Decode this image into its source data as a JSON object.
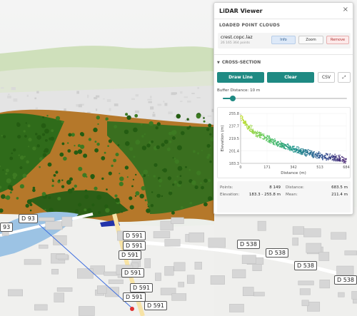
{
  "panel": {
    "title": "LiDAR Viewer",
    "close_icon": "×"
  },
  "loaded_point_clouds": {
    "label": "LOADED POINT CLOUDS",
    "items": [
      {
        "name": "crest.copc.laz",
        "points": "26 165 364 points",
        "info_label": "Info",
        "zoom_label": "Zoom",
        "remove_label": "Remove"
      }
    ]
  },
  "cross_section": {
    "label": "CROSS-SECTION",
    "chevron": "▼",
    "draw_line_label": "Draw Line",
    "clear_label": "Clear",
    "csv_label": "CSV",
    "expand_icon": "⤢",
    "buffer_label": "Buffer Distance: 10 m",
    "buffer_value": 10,
    "buffer_fraction": 0.08
  },
  "stats": {
    "points_label": "Points:",
    "points_value": "8 149",
    "distance_label": "Distance:",
    "distance_value": "683.5 m",
    "elevation_label": "Elevation:",
    "elevation_value": "183.3 - 255.8 m",
    "mean_label": "Mean:",
    "mean_value": "211.4 m"
  },
  "chart_data": {
    "type": "scatter",
    "xlabel": "Distance (m)",
    "ylabel": "Elevation (m)",
    "xlim": [
      0,
      684
    ],
    "ylim": [
      183.3,
      255.8
    ],
    "x_ticks": [
      "0",
      "171",
      "342",
      "513",
      "684"
    ],
    "y_ticks": [
      "255.8",
      "237.7",
      "219.5",
      "201.4",
      "183.3"
    ],
    "trend": [
      [
        0,
        250
      ],
      [
        40,
        237
      ],
      [
        100,
        226
      ],
      [
        171,
        218
      ],
      [
        260,
        209
      ],
      [
        342,
        203
      ],
      [
        430,
        197
      ],
      [
        513,
        193
      ],
      [
        600,
        190
      ],
      [
        684,
        187
      ]
    ],
    "spread": 7
  },
  "map": {
    "road_labels": [
      "D 93",
      "93",
      "D 591",
      "D 591",
      "D 591",
      "D 591",
      "D 591",
      "D 591",
      "D 591",
      "D 538",
      "D 538",
      "D 538",
      "D 538"
    ]
  }
}
